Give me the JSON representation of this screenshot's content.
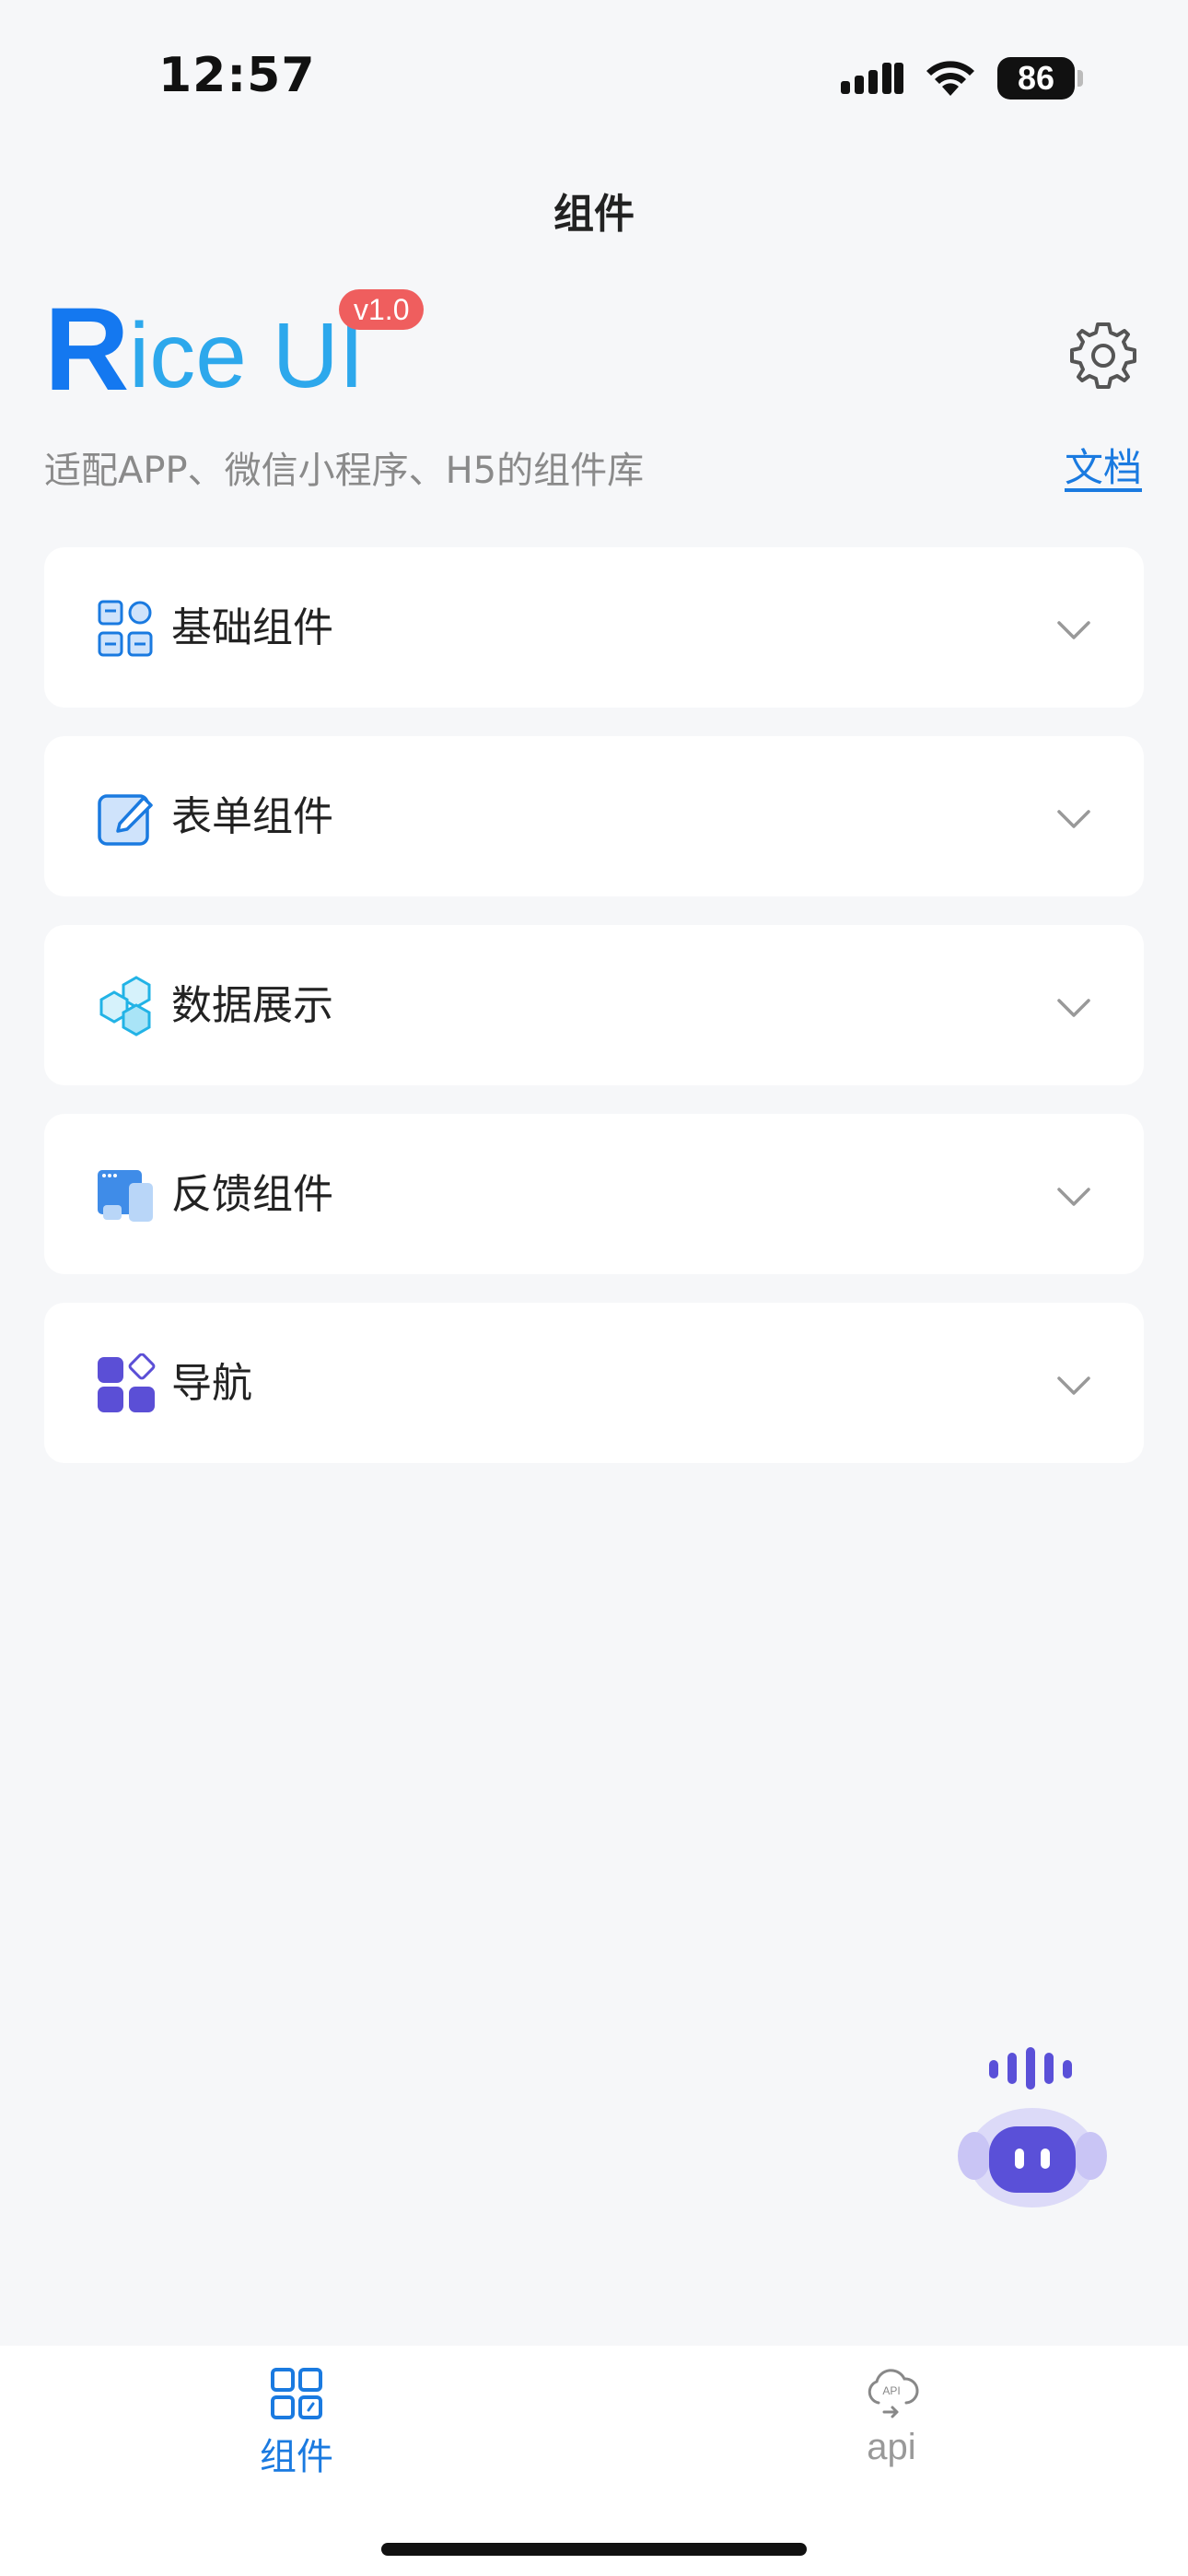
{
  "status_bar": {
    "time": "12:57",
    "battery": "86"
  },
  "nav": {
    "title": "组件"
  },
  "brand": {
    "name_first": "R",
    "name_rest": "ice UI",
    "version": "v1.0",
    "subtitle": "适配APP、微信小程序、H5的组件库",
    "docs_label": "文档"
  },
  "menu": [
    {
      "label": "基础组件",
      "icon": "grid-icon"
    },
    {
      "label": "表单组件",
      "icon": "edit-icon"
    },
    {
      "label": "数据展示",
      "icon": "hexagon-icon"
    },
    {
      "label": "反馈组件",
      "icon": "window-icon"
    },
    {
      "label": "导航",
      "icon": "apps-icon"
    }
  ],
  "tab_bar": {
    "tabs": [
      {
        "label": "组件",
        "icon": "components-icon",
        "active": true
      },
      {
        "label": "api",
        "icon": "cloud-api-icon",
        "active": false
      }
    ]
  },
  "colors": {
    "accent": "#1a7ae0",
    "badge": "#ef5e5e",
    "background": "#f6f7f9"
  }
}
